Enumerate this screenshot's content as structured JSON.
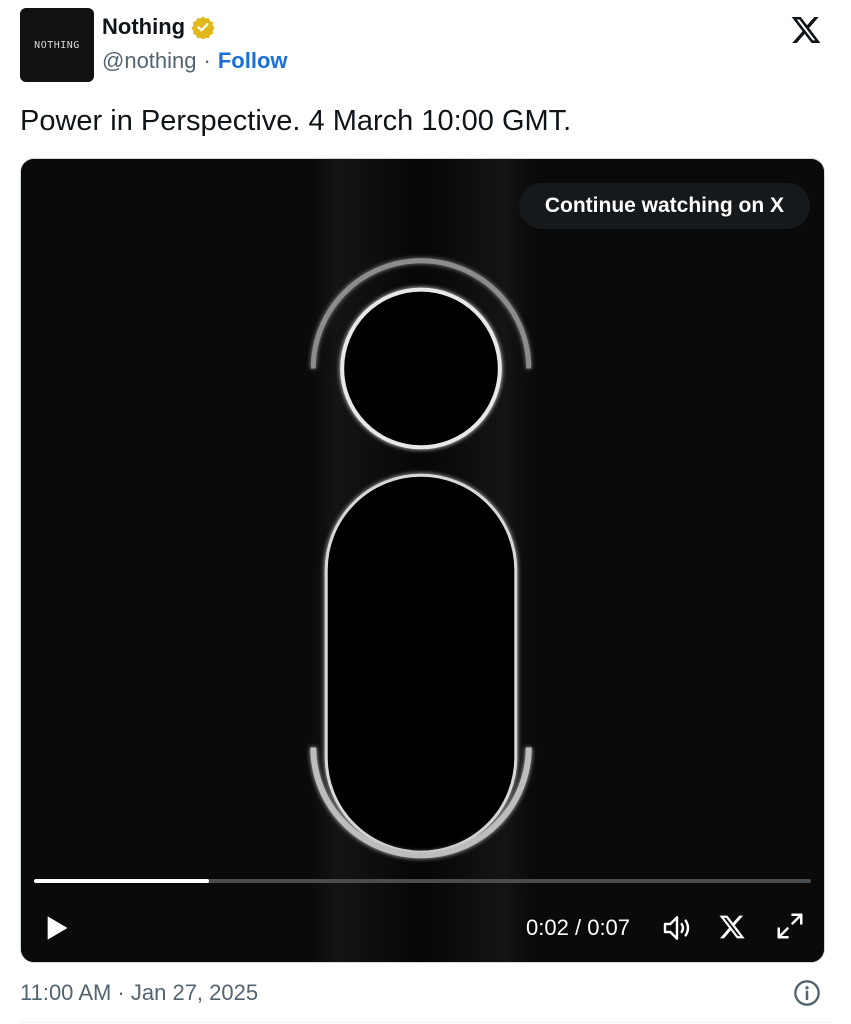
{
  "author": {
    "avatar_text": "NOTHING",
    "name": "Nothing",
    "handle": "@nothing",
    "separator": "·",
    "follow_label": "Follow",
    "verified_color": "#e2b719",
    "follow_color": "#1d6fd8"
  },
  "tweet": {
    "text": "Power in Perspective. 4 March 10:00 GMT.",
    "timestamp": "11:00 AM · Jan 27, 2025"
  },
  "video": {
    "continue_label": "Continue watching on X",
    "current_time": "0:02",
    "time_separator": "/",
    "duration": "0:07",
    "progress": 0.225
  },
  "icons": {
    "brand": "x-logo-icon",
    "verified": "verified-badge-icon",
    "play": "play-icon",
    "volume": "volume-icon",
    "x_video": "x-logo-icon",
    "fullscreen": "fullscreen-icon",
    "info": "info-icon"
  }
}
